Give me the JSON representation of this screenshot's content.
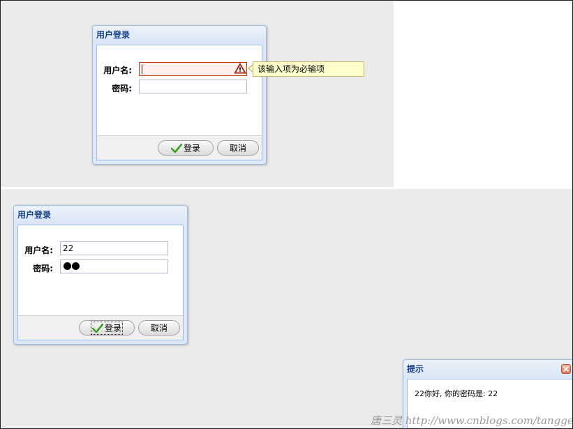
{
  "top_window": {
    "title": "用户登录",
    "username_label": "用户名:",
    "password_label": "密码:",
    "username_value": "",
    "password_value": "",
    "tooltip": "该输入项为必输项",
    "login_button": "登录",
    "cancel_button": "取消"
  },
  "bottom_window": {
    "title": "用户登录",
    "username_label": "用户名:",
    "password_label": "密码:",
    "username_value": "22",
    "password_dots": 2,
    "login_button": "登录",
    "cancel_button": "取消"
  },
  "alert_window": {
    "title": "提示",
    "message": "22你好, 你的密码是: 22"
  },
  "watermark": "唐三灵 http://www.cnblogs.com/tangge",
  "colors": {
    "window_border": "#99bbe8",
    "title_text": "#15428b",
    "invalid_border": "#cc3300",
    "invalid_bg": "#fff0f0",
    "tooltip_bg": "#ffffcc",
    "check_green": "#3aa020",
    "warn_red": "#cc2200"
  },
  "icons": {
    "warning": "warning-icon",
    "check": "check-icon",
    "close": "close-icon"
  }
}
